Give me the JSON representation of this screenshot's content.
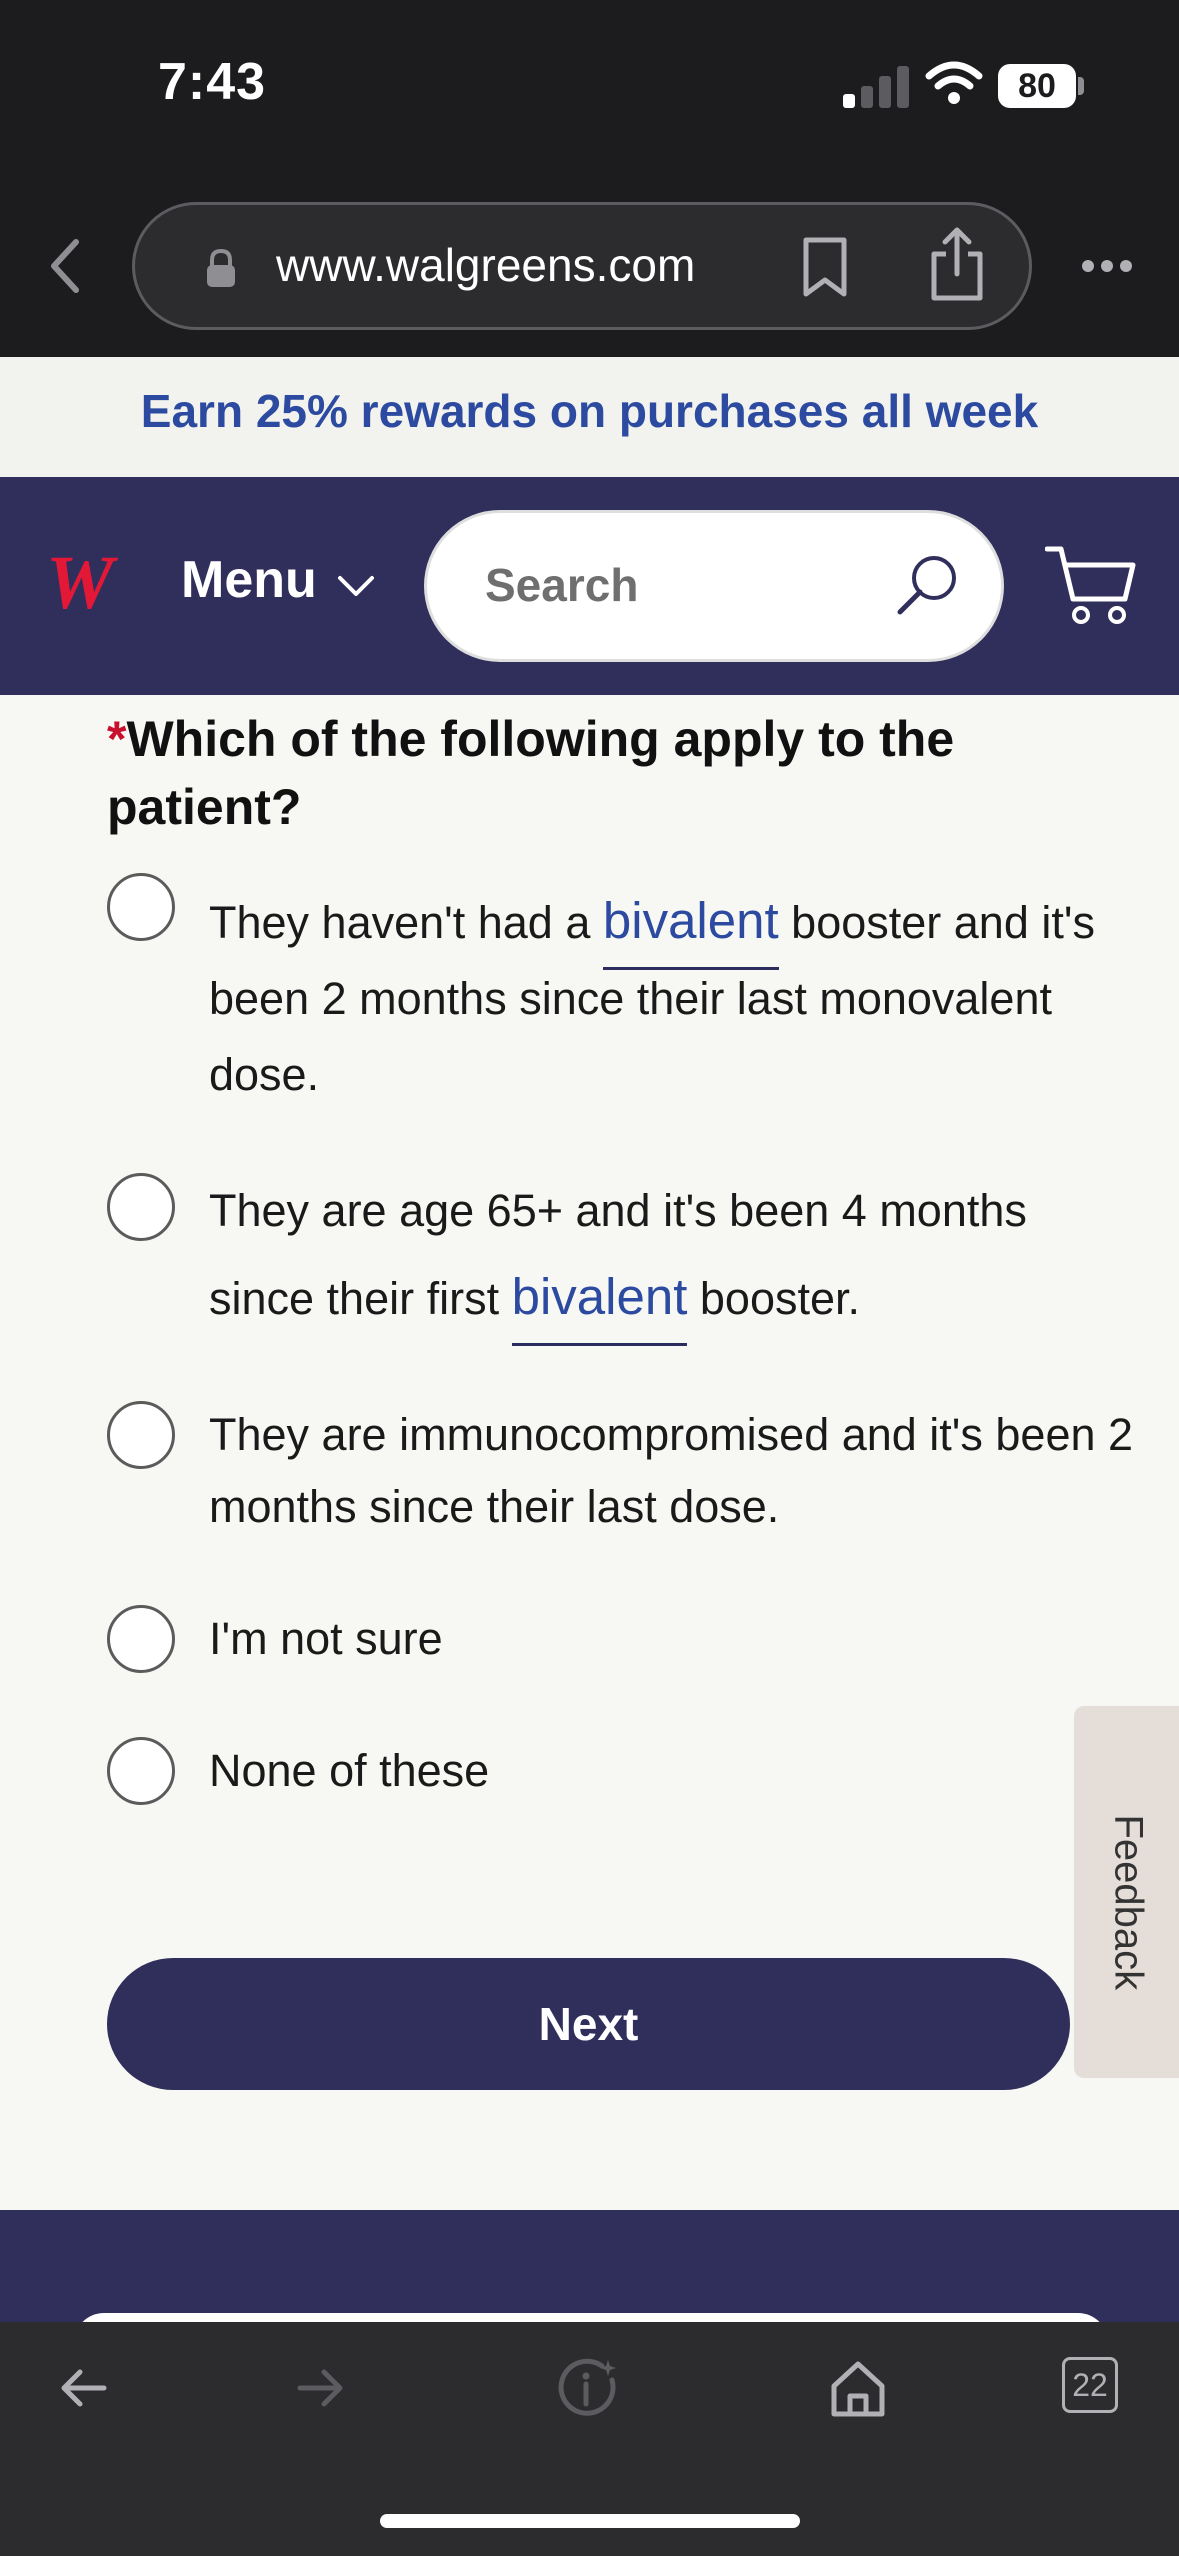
{
  "status_bar": {
    "time": "7:43",
    "battery": "80"
  },
  "browser": {
    "url": "www.walgreens.com",
    "tabs_count": "22"
  },
  "promo": {
    "text": "Earn 25% rewards on purchases all week"
  },
  "header": {
    "logo": "W",
    "menu_label": "Menu",
    "search_placeholder": "Search"
  },
  "question": {
    "asterisk": "*",
    "title": "Which of the following apply to the patient?",
    "options": [
      {
        "before": "They haven't had a ",
        "link": "bivalent",
        "after": " booster and it's been 2 months since their last monovalent dose."
      },
      {
        "before": "They are age 65+ and it's been 4 months since their first ",
        "link": "bivalent",
        "after": " booster."
      },
      {
        "text": "They are immunocompromised and it's been 2 months since their last dose."
      },
      {
        "text": "I'm not sure"
      },
      {
        "text": "None of these"
      }
    ]
  },
  "next_button": "Next",
  "feedback_tab": "Feedback",
  "colors": {
    "brand_navy": "#302f5c",
    "link_blue": "#2c4aa0",
    "required_red": "#c8102e",
    "logo_red": "#e31837"
  }
}
